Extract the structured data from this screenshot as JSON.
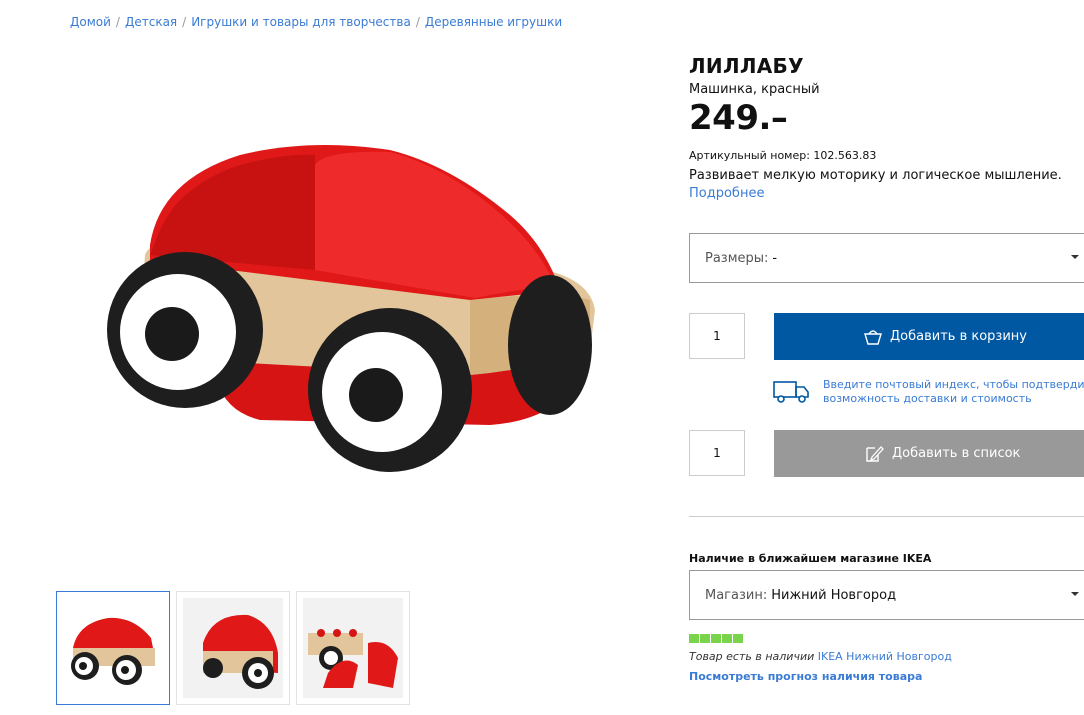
{
  "breadcrumb": {
    "items": [
      "Домой",
      "Детская",
      "Игрушки и товары для творчества",
      "Деревянные игрушки"
    ],
    "separator": "/"
  },
  "product": {
    "name": "ЛИЛЛАБУ",
    "subtitle": "Машинка, красный",
    "price": "249.–",
    "article": "Артикульный номер: 102.563.83",
    "description": "Развивает мелкую моторику и логическое мышление.",
    "more_link": "Подробнее"
  },
  "size_select": {
    "label": "Размеры:",
    "value": "-"
  },
  "cart": {
    "quantity": "1",
    "button_label": "Добавить в корзину",
    "icon": "basket-icon"
  },
  "delivery": {
    "icon": "truck-icon",
    "line1": "Введите почтовый индекс, чтобы подтвердит",
    "line2": "возможность доставки и стоимость"
  },
  "wishlist": {
    "quantity": "1",
    "button_label": "Добавить в список",
    "icon": "pencil-list-icon"
  },
  "availability": {
    "title": "Наличие в ближайшем магазине IKEA",
    "store_label": "Магазин:",
    "store_value": "Нижний Новгород",
    "stock_level": "5/5",
    "stock_text": "Товар есть в наличии",
    "stock_store": "IKEA Нижний Новгород",
    "forecast_link": "Посмотреть прогноз наличия товара"
  },
  "colors": {
    "link": "#3a7bd5",
    "cart_button": "#0058a3",
    "list_button": "#999999",
    "stock": "#7ad44b",
    "car_red": "#e01818"
  }
}
